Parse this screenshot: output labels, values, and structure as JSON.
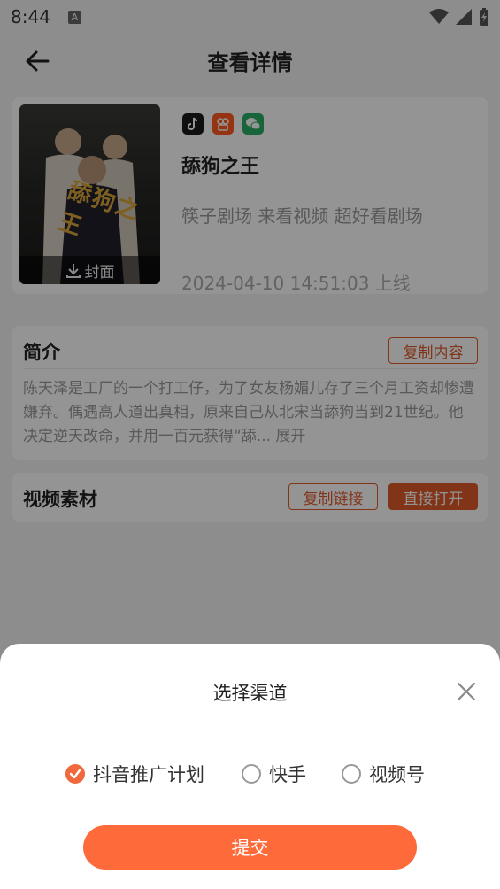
{
  "status_bar": {
    "time": "8:44",
    "a_badge": "A"
  },
  "header": {
    "title": "查看详情",
    "back_icon": "arrow-left-icon"
  },
  "drama": {
    "platform_icons": [
      "tiktok-icon",
      "kuaishou-icon",
      "wechat-icon"
    ],
    "poster_title": "舔狗之王",
    "cover_label": "封面",
    "name": "舔狗之王",
    "channels": "筷子剧场 来看视频 超好看剧场",
    "release": "2024-04-10 14:51:03 上线"
  },
  "intro": {
    "title": "简介",
    "copy_button": "复制内容",
    "text": "陈天泽是工厂的一个打工仔，为了女友杨媚儿存了三个月工资却惨遭嫌弃。偶遇高人道出真相，原来自己从北宋当舔狗当到21世纪。他决定逆天改命，并用一百元获得“舔...",
    "expand": "展开"
  },
  "video": {
    "title": "视频素材",
    "copy_link_button": "复制链接",
    "open_button": "直接打开"
  },
  "sheet": {
    "title": "选择渠道",
    "options": [
      {
        "label": "抖音推广计划",
        "selected": true
      },
      {
        "label": "快手",
        "selected": false
      },
      {
        "label": "视频号",
        "selected": false
      }
    ],
    "submit": "提交"
  },
  "colors": {
    "accent": "#ff6a3a",
    "outline": "#e05a2a"
  }
}
